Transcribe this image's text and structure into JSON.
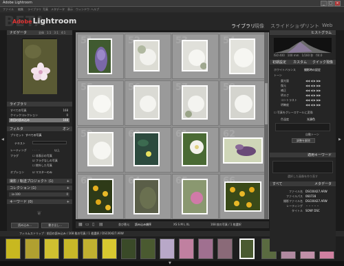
{
  "window": {
    "title": "Adobe Lightroom"
  },
  "menu": {
    "items": [
      "ファイル",
      "編集",
      "ライブラリ",
      "写真",
      "メタデータ",
      "表示",
      "ウィンドウ",
      "ヘルプ"
    ]
  },
  "logo": {
    "adobe": "Adobe",
    "name": "Lightroom"
  },
  "modules": [
    "ライブラリ",
    "現像",
    "スライドショー",
    "プリント",
    "Web"
  ],
  "left_panel": {
    "navigator": {
      "title": "ナビゲータ",
      "zoom": "全体　1:1　3:1　4:1"
    },
    "library": {
      "title": "ライブラリ",
      "items": [
        {
          "label": "すべての写真",
          "count": "168"
        },
        {
          "label": "クイックコレクション",
          "count": "0"
        },
        {
          "label": "前回の読み込み",
          "count": "168"
        }
      ]
    },
    "filter": {
      "title": "フィルタ",
      "toggle": "オン",
      "preset_label": "プリセット",
      "preset_value": "すべての写真",
      "text_label": "テキスト",
      "rating_label": "レーティング",
      "rating_op": "以上",
      "flag_label": "フラグ",
      "flags": [
        "非表示の写真",
        "フラグなしの写真",
        "除外した写真"
      ],
      "options_label": "オプション",
      "master": "マスターのみ"
    },
    "sections": [
      {
        "title": "撮影 / 転送プロジェクト",
        "count": "(1)"
      },
      {
        "title": "コレクション",
        "count": "(1)"
      },
      {
        "title": "キーワード",
        "count": "(0)"
      }
    ],
    "collection_item": "ia-100",
    "import_button": "読み込み...",
    "export_button": "書き出し..."
  },
  "grid": {
    "numbers": [
      "51",
      "52",
      "53",
      "54",
      "55",
      "56",
      "57",
      "58",
      "59",
      "60",
      "61",
      "62",
      "63",
      "64",
      "65",
      "66"
    ]
  },
  "toolbar": {
    "sort_label": "並び替え:",
    "sort_value": "読み込み順序",
    "size_labels": "XS S M L XL",
    "count_text": "168 枚の写真 / 1 枚選択"
  },
  "filmstrip": {
    "header": "フィルムストリップ : 前回の読み込み / 168 枚の写真 / 1 枚選択 / DSC00427.ARW",
    "filter_label": "すべての写真"
  },
  "right_panel": {
    "histogram": {
      "title": "ヒストグラム",
      "iso": "ISO 400",
      "focal": "100 mm",
      "fstop": "1/160 秒",
      "ev": "f/4.0"
    },
    "quick_develop": {
      "title": "クイック現像",
      "preset_label": "初期設定",
      "preset_value": "カスタム",
      "wb_label": "ホワイトバランス",
      "wb_value": "撮影時の設定",
      "tone_label": "トーン",
      "rows": [
        "露光量",
        "復元",
        "補正",
        "明るさ",
        "コントラスト",
        "明瞭度"
      ],
      "bw_label": "写真をグレースケールに変換",
      "color_label": "色温度",
      "color_value": "光源色",
      "auto_tone": "自動トーン",
      "reset": "調整を解除"
    },
    "keywords": {
      "title": "適用キーワード",
      "placeholder": "選択した画像を作り直す"
    },
    "metadata": {
      "title": "メタデータ",
      "preset_label": "すべて",
      "rows": [
        {
          "label": "ファイル名",
          "value": "DSC00427.ARW"
        },
        {
          "label": "ファイルパス",
          "value": "060728"
        },
        {
          "label": "撮影ファイル名",
          "value": "DSC00427.ARW"
        },
        {
          "label": "レーティング",
          "value": "・・・・・"
        },
        {
          "label": "タイトル",
          "value": "SONY DSC"
        }
      ]
    }
  }
}
